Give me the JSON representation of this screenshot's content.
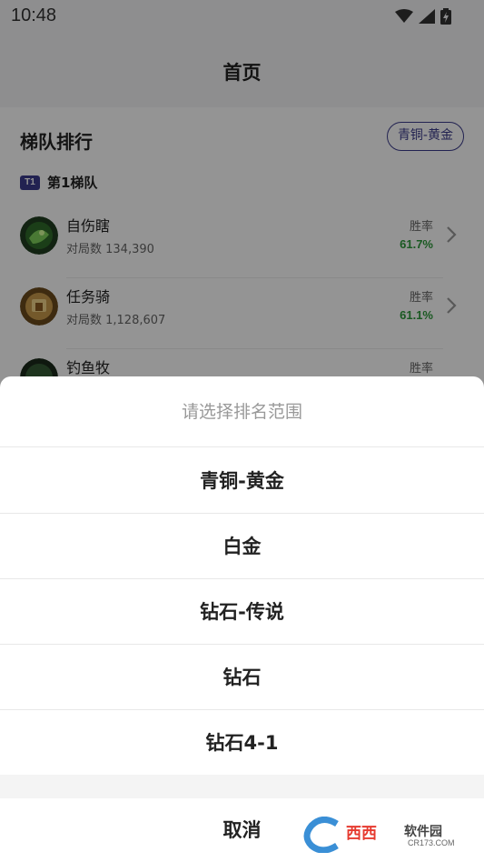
{
  "status_bar": {
    "time": "10:48"
  },
  "header": {
    "title": "首页"
  },
  "rankings": {
    "section_title": "梯队排行",
    "range_chip": "青铜-黄金",
    "tier": {
      "badge": "T1",
      "label": "第1梯队"
    },
    "heroes": [
      {
        "name": "自伤瞎",
        "games": "对局数 134,390",
        "winrate_label": "胜率",
        "winrate": "61.7%"
      },
      {
        "name": "任务骑",
        "games": "对局数 1,128,607",
        "winrate_label": "胜率",
        "winrate": "61.1%"
      },
      {
        "name": "钓鱼牧",
        "games": "",
        "winrate_label": "胜率",
        "winrate": ""
      }
    ]
  },
  "range_sheet": {
    "title": "请选择排名范围",
    "options": [
      "青铜-黄金",
      "白金",
      "钻石-传说",
      "钻石",
      "钻石4-1"
    ],
    "cancel_label": "取消"
  },
  "watermark": {
    "brand": "西西",
    "sub": "软件园",
    "url": "CR173.COM"
  },
  "colors": {
    "accent": "#3b3c8c",
    "winrate": "#2e9a3c"
  }
}
